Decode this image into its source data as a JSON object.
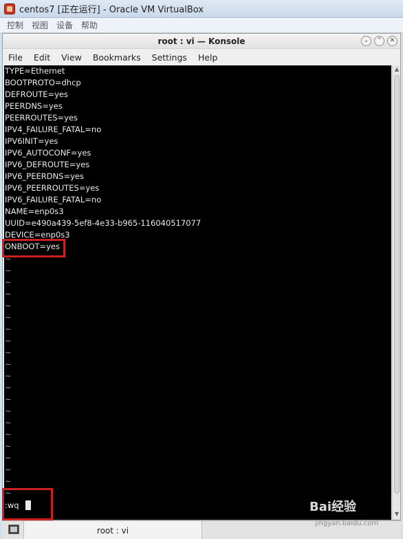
{
  "window": {
    "title": "centos7 [正在运行] - Oracle VM VirtualBox",
    "menu": [
      "控制",
      "视图",
      "设备",
      "帮助"
    ]
  },
  "konsole": {
    "title": "root : vi — Konsole",
    "menu": [
      "File",
      "Edit",
      "View",
      "Bookmarks",
      "Settings",
      "Help"
    ]
  },
  "terminal": {
    "lines": [
      "TYPE=Ethernet",
      "BOOTPROTO=dhcp",
      "DEFROUTE=yes",
      "PEERDNS=yes",
      "PEERROUTES=yes",
      "IPV4_FAILURE_FATAL=no",
      "IPV6INIT=yes",
      "IPV6_AUTOCONF=yes",
      "IPV6_DEFROUTE=yes",
      "IPV6_PEERDNS=yes",
      "IPV6_PEERROUTES=yes",
      "IPV6_FAILURE_FATAL=no",
      "NAME=enp0s3",
      "UUID=e490a439-5ef8-4e33-b965-116040517077",
      "DEVICE=enp0s3",
      "ONBOOT=yes"
    ],
    "tilde": "~",
    "command": ":wq"
  },
  "tabbar": {
    "tab_label": "root : vi"
  },
  "watermark": {
    "brand": "Bai经验",
    "url": "jingyan.baidu.com"
  },
  "colors": {
    "highlight": "#cc1f1f",
    "terminal_bg": "#000000"
  }
}
